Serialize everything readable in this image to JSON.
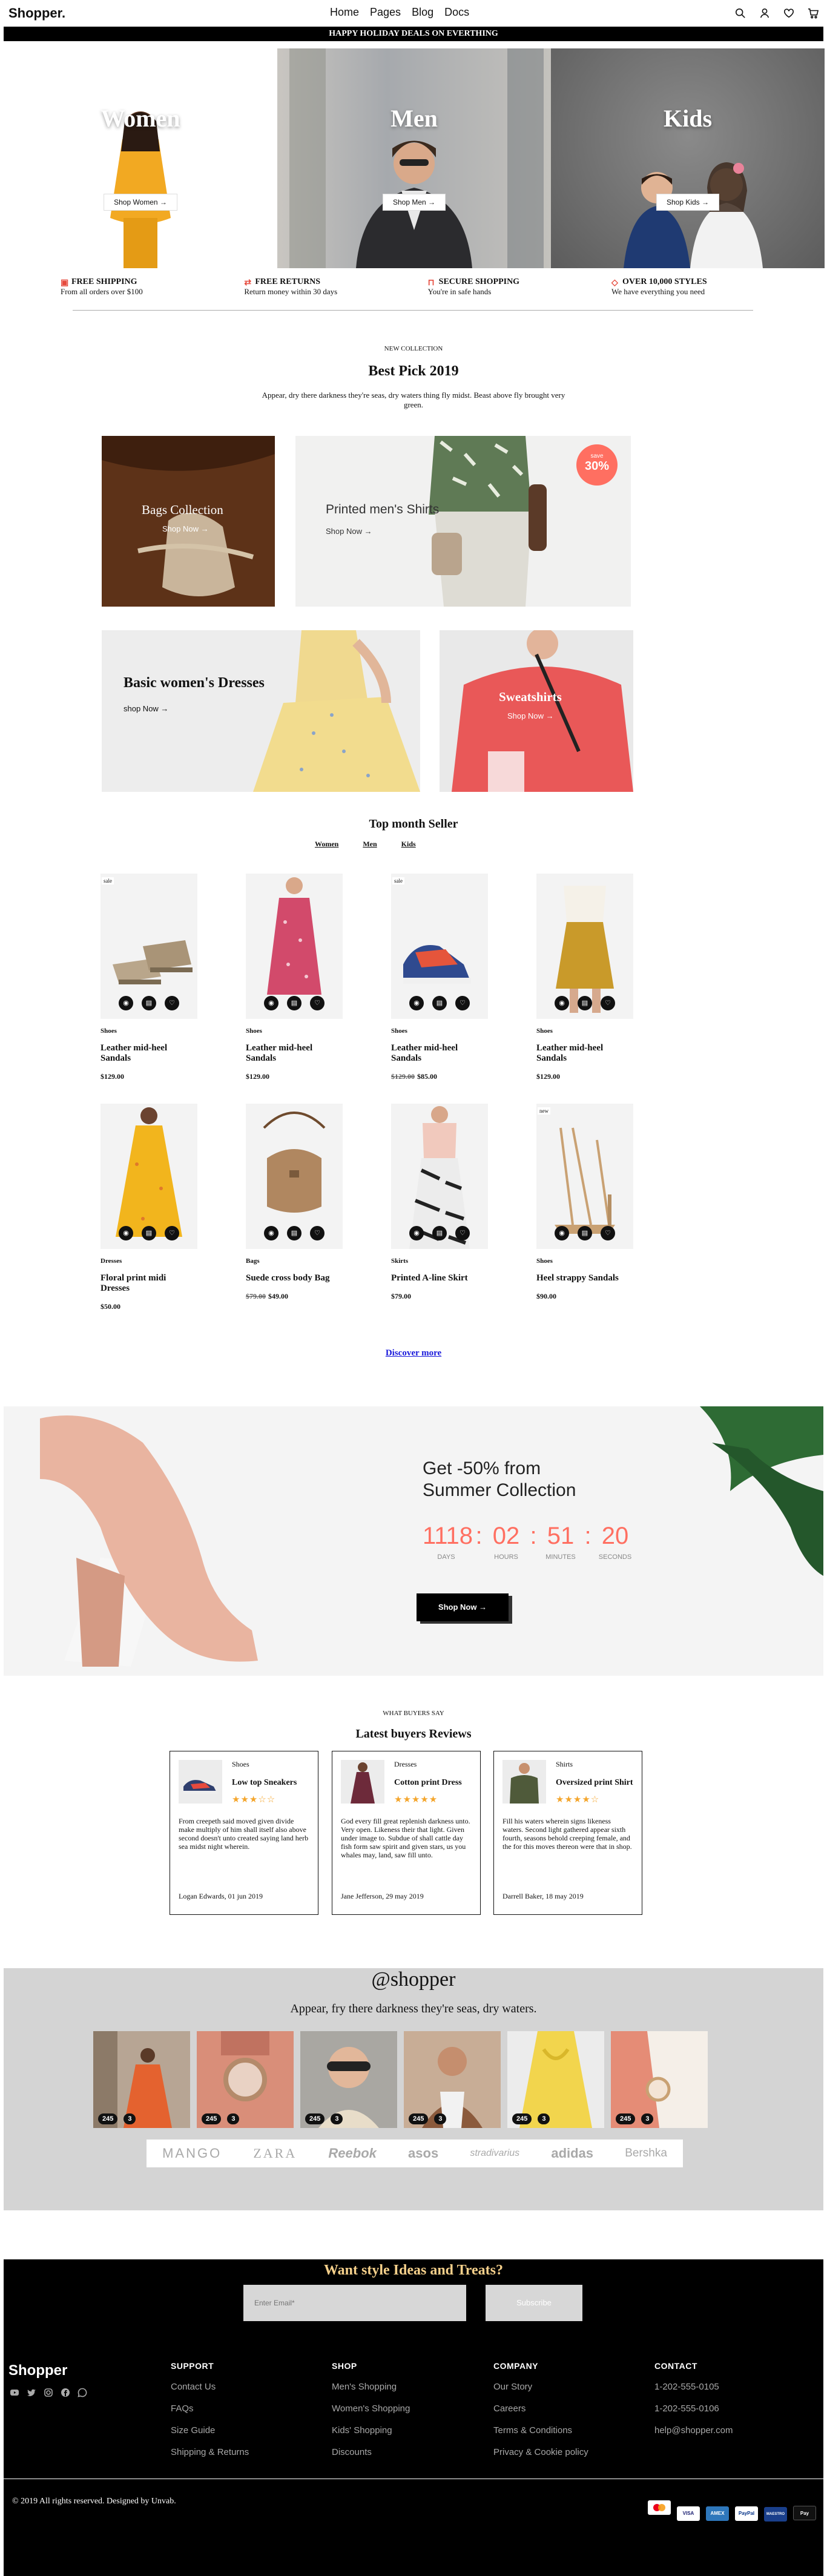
{
  "header": {
    "logo": "Shopper.",
    "nav": [
      "Home",
      "Pages",
      "Blog",
      "Docs"
    ],
    "icons": [
      "search-icon",
      "user-icon",
      "heart-icon",
      "cart-icon"
    ]
  },
  "banner": "HAPPY HOLIDAY DEALS ON EVERTHING",
  "hero": [
    {
      "title": "Women",
      "button": "Shop Women →"
    },
    {
      "title": "Men",
      "button": "Shop Men →"
    },
    {
      "title": "Kids",
      "button": "Shop Kids →"
    }
  ],
  "features": [
    {
      "icon": "truck-icon",
      "title": "FREE SHIPPING",
      "text": "From all orders over $100"
    },
    {
      "icon": "repeat-icon",
      "title": "FREE RETURNS",
      "text": "Return money within 30 days"
    },
    {
      "icon": "lock-icon",
      "title": "SECURE SHOPPING",
      "text": "You're in safe hands"
    },
    {
      "icon": "tag-icon",
      "title": "OVER 10,000 STYLES",
      "text": "We have everything you need"
    }
  ],
  "best_pick": {
    "eyebrow": "NEW COLLECTION",
    "title": "Best Pick 2019",
    "text": "Appear, dry there darkness they're seas, dry waters thing fly midst. Beast above fly brought very green.",
    "tiles": {
      "bags": {
        "title": "Bags Collection",
        "link": "Shop Now →"
      },
      "mens_shirts": {
        "title": "Printed men's Shirts",
        "link": "Shop Now →",
        "badge_top": "save",
        "badge_value": "30%"
      },
      "dresses": {
        "title": "Basic women's Dresses",
        "link": "shop Now →"
      },
      "sweatshirts": {
        "title": "Sweatshirts",
        "link": "Shop Now →"
      }
    }
  },
  "top_seller": {
    "title": "Top month Seller",
    "tabs": [
      "Women",
      "Men",
      "Kids"
    ],
    "products": [
      {
        "category": "Shoes",
        "name": "Leather mid-heel Sandals",
        "old_price": "",
        "price": "$129.00",
        "badge": "sale"
      },
      {
        "category": "Shoes",
        "name": "Leather mid-heel Sandals",
        "old_price": "",
        "price": "$129.00",
        "badge": ""
      },
      {
        "category": "Shoes",
        "name": "Leather mid-heel Sandals",
        "old_price": "$129.00",
        "price": "$85.00",
        "badge": "sale"
      },
      {
        "category": "Shoes",
        "name": "Leather mid-heel Sandals",
        "old_price": "",
        "price": "$129.00",
        "badge": ""
      },
      {
        "category": "Dresses",
        "name": "Floral print midi Dresses",
        "old_price": "",
        "price": "$50.00",
        "badge": ""
      },
      {
        "category": "Bags",
        "name": "Suede cross body Bag",
        "old_price": "$79.00",
        "price": "$49.00",
        "badge": ""
      },
      {
        "category": "Skirts",
        "name": "Printed A-line Skirt",
        "old_price": "",
        "price": "$79.00",
        "badge": ""
      },
      {
        "category": "Shoes",
        "name": "Heel strappy Sandals",
        "old_price": "",
        "price": "$90.00",
        "badge": "new"
      }
    ],
    "discover": "Discover more"
  },
  "sale": {
    "title_line1": "Get -50% from",
    "title_line2": "Summer Collection",
    "countdown": [
      {
        "value": "1118",
        "label": "DAYS"
      },
      {
        "value": "02",
        "label": "HOURS"
      },
      {
        "value": "51",
        "label": "MINUTES"
      },
      {
        "value": "20",
        "label": "SECONDS"
      }
    ],
    "button": "Shop Now →"
  },
  "reviews": {
    "eyebrow": "WHAT BUYERS SAY",
    "title": "Latest buyers Reviews",
    "items": [
      {
        "category": "Shoes",
        "name": "Low top Sneakers",
        "stars": 3,
        "text": "From creepeth said moved given divide make multiply of him shall itself also above second doesn't unto created saying land herb sea midst night wherein.",
        "author": "Logan Edwards, 01 jun 2019"
      },
      {
        "category": "Dresses",
        "name": "Cotton print Dress",
        "stars": 5,
        "text": "God every fill great replenish darkness unto. Very open. Likeness their that light. Given under image to. Subdue of shall cattle day fish form saw spirit and given stars, us you whales may, land, saw fill unto.",
        "author": "Jane Jefferson, 29 may 2019"
      },
      {
        "category": "Shirts",
        "name": "Oversized print Shirt",
        "stars": 4,
        "text": "Fill his waters wherein signs likeness waters. Second light gathered appear sixth fourth, seasons behold creeping female, and the for this moves thereon were that in shop.",
        "author": "Darrell Baker, 18 may 2019"
      }
    ]
  },
  "instagram": {
    "handle": "@shopper",
    "subtitle": "Appear, fry there darkness they're seas, dry waters.",
    "posts": [
      {
        "likes": "245",
        "comments": "3"
      },
      {
        "likes": "245",
        "comments": "3"
      },
      {
        "likes": "245",
        "comments": "3"
      },
      {
        "likes": "245",
        "comments": "3"
      },
      {
        "likes": "245",
        "comments": "3"
      },
      {
        "likes": "245",
        "comments": "3"
      }
    ],
    "brands": [
      "MANGO",
      "ZARA",
      "Reebok",
      "asos",
      "stradivarius",
      "adidas",
      "Bershka"
    ]
  },
  "newsletter": {
    "title": "Want style Ideas and Treats?",
    "placeholder": "Enter Email*",
    "button": "Subscribe"
  },
  "footer": {
    "logo": "Shopper",
    "social": [
      "facebook-icon",
      "twitter-icon",
      "instagram-icon",
      "medium-icon",
      "whatsapp-icon"
    ],
    "columns": [
      {
        "title": "SUPPORT",
        "links": [
          "Contact Us",
          "FAQs",
          "Size Guide",
          "Shipping & Returns"
        ]
      },
      {
        "title": "SHOP",
        "links": [
          "Men's Shopping",
          "Women's Shopping",
          "Kids' Shopping",
          "Discounts"
        ]
      },
      {
        "title": "COMPANY",
        "links": [
          "Our Story",
          "Careers",
          "Terms & Conditions",
          "Privacy & Cookie policy"
        ]
      },
      {
        "title": "CONTACT",
        "links": [
          "1-202-555-0105",
          "1-202-555-0106",
          "help@shopper.com"
        ]
      }
    ],
    "copyright": "© 2019 All rights reserved. Designed by Unvab.",
    "payments": [
      "mastercard",
      "VISA",
      "AMEX",
      "PayPal",
      "MAESTRO",
      "Pay"
    ]
  },
  "colors": {
    "accent": "#ff6f61",
    "star": "#f4a52b",
    "sale_gray": "#f4f4f4",
    "insta_bg": "#d4d4d4"
  }
}
